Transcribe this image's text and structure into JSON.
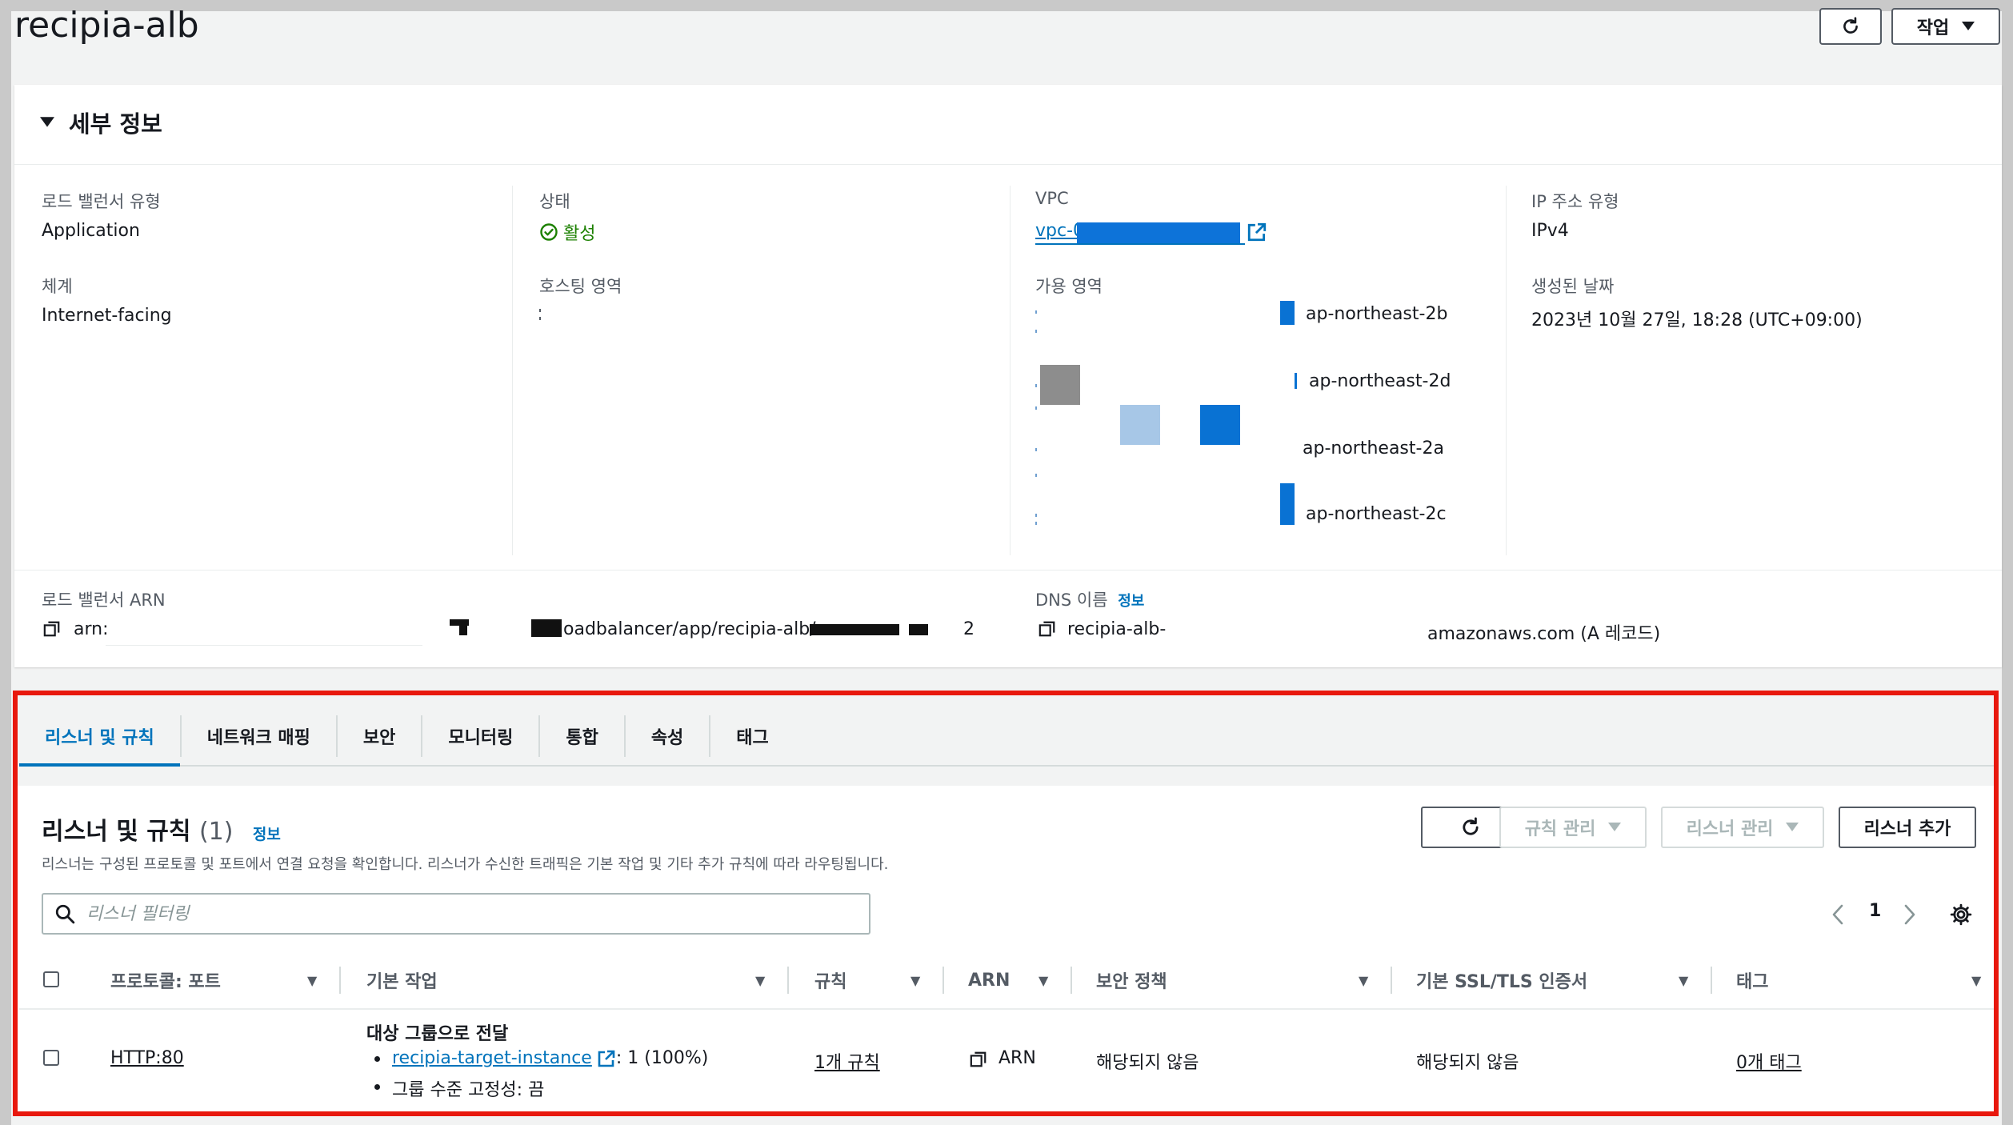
{
  "page": {
    "title": "recipia-alb"
  },
  "header": {
    "actions_label": "작업"
  },
  "details": {
    "section_title": "세부 정보",
    "lb_type_label": "로드 밸런서 유형",
    "lb_type_value": "Application",
    "state_label": "상태",
    "state_value": "활성",
    "vpc_label": "VPC",
    "vpc_value": "vpc-0",
    "ip_type_label": "IP 주소 유형",
    "ip_type_value": "IPv4",
    "scheme_label": "체계",
    "scheme_value": "Internet-facing",
    "hosted_zone_label": "호스팅 영역",
    "az_label": "가용 영역",
    "created_label": "생성된 날짜",
    "created_value": "2023년 10월 27일, 18:28 (UTC+09:00)",
    "az_items": [
      "ap-northeast-2b",
      "ap-northeast-2d",
      "ap-northeast-2a",
      "ap-northeast-2c"
    ],
    "arn_label": "로드 밸런서 ARN",
    "arn_prefix": "arn:",
    "arn_visible": "oadbalancer/app/recipia-alb/",
    "arn_tail": "2",
    "dns_label": "DNS 이름",
    "dns_info": "정보",
    "dns_prefix": "recipia-alb-",
    "dns_suffix": "amazonaws.com (A 레코드)"
  },
  "tabs": [
    "리스너 및 규칙",
    "네트워크 매핑",
    "보안",
    "모니터링",
    "통합",
    "속성",
    "태그"
  ],
  "listeners": {
    "title": "리스너 및 규칙",
    "count": "(1)",
    "info": "정보",
    "description": "리스너는 구성된 프로토콜 및 포트에서 연결 요청을 확인합니다. 리스너가 수신한 트래픽은 기본 작업 및 기타 추가 규칙에 따라 라우팅됩니다.",
    "manage_rules": "규칙 관리",
    "manage_listener": "리스너 관리",
    "add_listener": "리스너 추가",
    "filter_placeholder": "리스너 필터링",
    "page_number": "1",
    "columns": [
      "프로토콜: 포트",
      "기본 작업",
      "규칙",
      "ARN",
      "보안 정책",
      "기본 SSL/TLS 인증서",
      "태그"
    ],
    "row": {
      "protocol_port": "HTTP:80",
      "action_title": "대상 그룹으로 전달",
      "target_group": "recipia-target-instance",
      "target_weight": ": 1 (100%)",
      "stickiness": "그룹 수준 고정성: 끔",
      "rules": "1개 규칙",
      "arn": "ARN",
      "security_policy": "해당되지 않음",
      "ssl_cert": "해당되지 않음",
      "tags": "0개 태그"
    }
  },
  "colors": {
    "accent": "#0073bb",
    "success": "#1d8102",
    "highlight": "#e8180d"
  }
}
